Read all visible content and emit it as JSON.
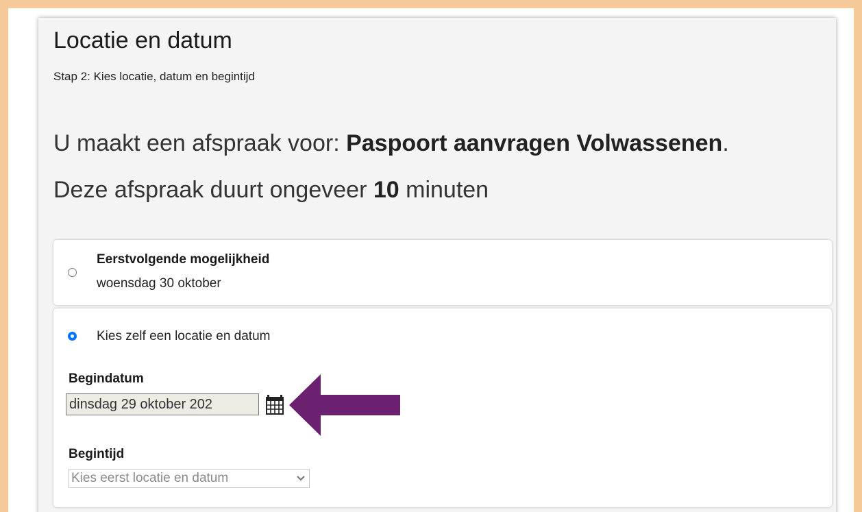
{
  "header": {
    "title": "Locatie en datum",
    "subtitle": "Stap 2: Kies locatie, datum en begintijd"
  },
  "intro": {
    "appointment_prefix": "U maakt een afspraak voor: ",
    "appointment_type": "Paspoort aanvragen Volwassenen",
    "appointment_suffix": ".",
    "duration_prefix": "Deze afspraak duurt ongeveer ",
    "duration_value": "10",
    "duration_suffix": " minuten"
  },
  "options": {
    "first_available": {
      "title": "Eerstvolgende mogelijkheid",
      "date": "woensdag 30 oktober",
      "selected": false
    },
    "choose_self": {
      "label": "Kies zelf een locatie en datum",
      "selected": true
    }
  },
  "form": {
    "start_date_label": "Begindatum",
    "start_date_value": "dinsdag 29 oktober 202",
    "start_time_label": "Begintijd",
    "start_time_placeholder": "Kies eerst locatie en datum"
  },
  "icons": {
    "calendar": "calendar-icon",
    "dropdown": "chevron-down-icon",
    "annotation": "arrow-left-icon"
  },
  "colors": {
    "frame_border": "#f6c998",
    "radio_accent": "#0075ff",
    "annotation_arrow": "#6b2170"
  }
}
